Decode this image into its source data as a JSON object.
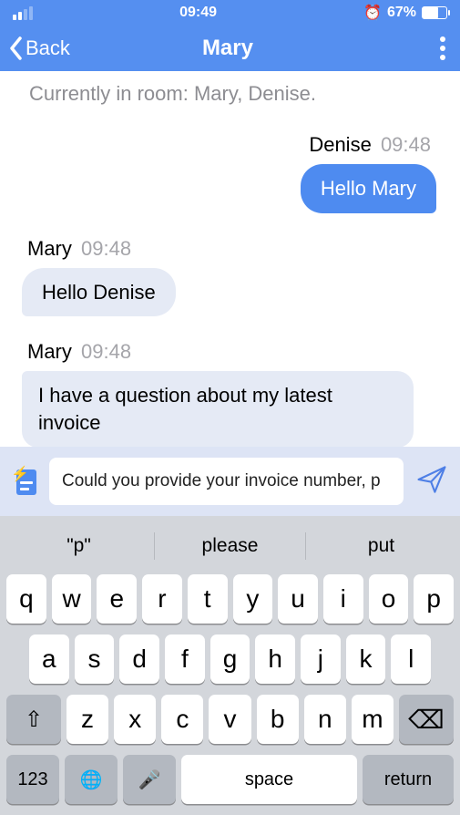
{
  "status": {
    "time": "09:49",
    "battery_pct": "67%",
    "battery_fill_width": "67%"
  },
  "nav": {
    "back_label": "Back",
    "title": "Mary"
  },
  "room_info": "Currently in room: Mary, Denise.",
  "messages": [
    {
      "side": "right",
      "name": "Denise",
      "time": "09:48",
      "text": "Hello Mary",
      "style": "out"
    },
    {
      "side": "left",
      "name": "Mary",
      "time": "09:48",
      "text": "Hello Denise",
      "style": "in"
    },
    {
      "side": "left",
      "name": "Mary",
      "time": "09:48",
      "text": "I have a question about my latest invoice",
      "style": "in",
      "wide": true
    }
  ],
  "compose": {
    "input_text": "Could you provide your invoice number, p"
  },
  "keyboard": {
    "suggestions": [
      "\"p\"",
      "please",
      "put"
    ],
    "row1": [
      "q",
      "w",
      "e",
      "r",
      "t",
      "y",
      "u",
      "i",
      "o",
      "p"
    ],
    "row2": [
      "a",
      "s",
      "d",
      "f",
      "g",
      "h",
      "j",
      "k",
      "l"
    ],
    "row3": [
      "z",
      "x",
      "c",
      "v",
      "b",
      "n",
      "m"
    ],
    "numkey": "123",
    "space": "space",
    "return": "return"
  }
}
